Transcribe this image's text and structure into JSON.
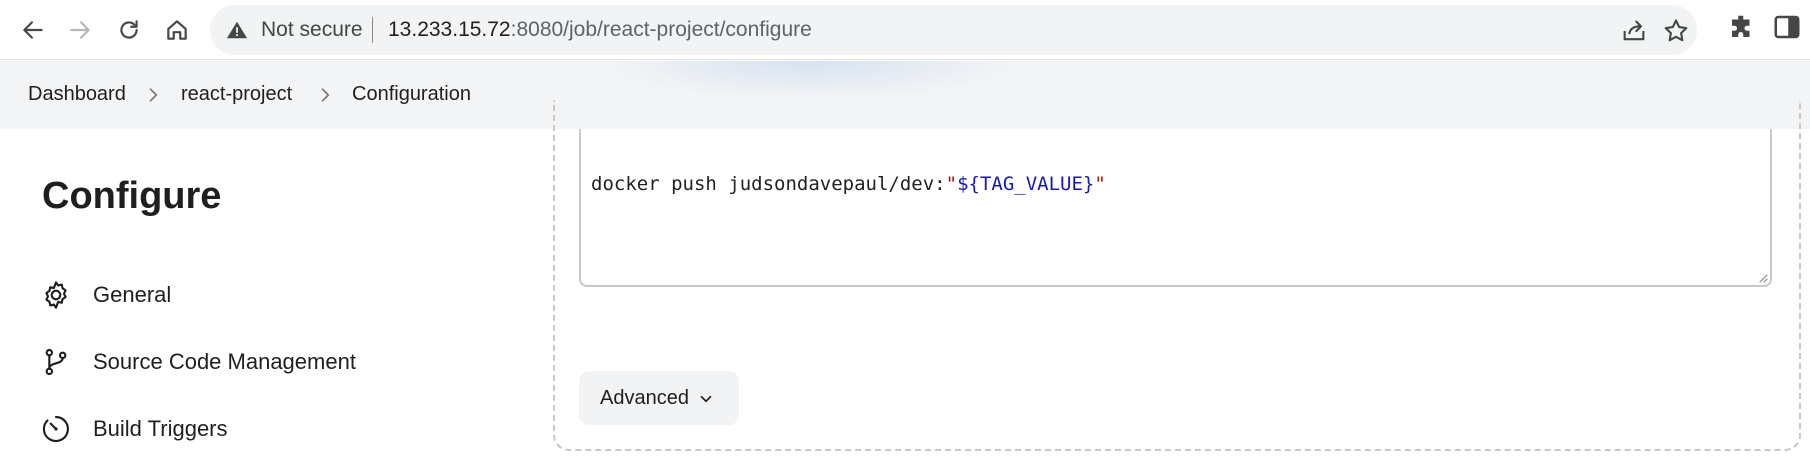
{
  "browser": {
    "security_label": "Not secure",
    "url_host": "13.233.15.72",
    "url_rest": ":8080/job/react-project/configure",
    "icons": [
      "back-icon",
      "forward-icon",
      "reload-icon",
      "home-icon",
      "warning-icon",
      "share-icon",
      "star-icon",
      "extensions-icon",
      "side-panel-icon"
    ]
  },
  "breadcrumb": {
    "items": [
      "Dashboard",
      "react-project",
      "Configuration"
    ]
  },
  "sidebar": {
    "title": "Configure",
    "items": [
      {
        "label": "General",
        "icon": "gear-icon"
      },
      {
        "label": "Source Code Management",
        "icon": "branch-icon"
      },
      {
        "label": "Build Triggers",
        "icon": "clock-icon"
      }
    ]
  },
  "main": {
    "code": {
      "prefix": "docker push judsondavepaul/dev:",
      "quote_open": "\"",
      "variable": "${TAG_VALUE}",
      "quote_close": "\""
    },
    "advanced_label": "Advanced"
  },
  "colors": {
    "accent_variable": "#1a1aa6",
    "string_quote": "#a31515",
    "breadcrumb_bg": "#f3f4f6",
    "omnibox_bg": "#f1f3f4"
  }
}
